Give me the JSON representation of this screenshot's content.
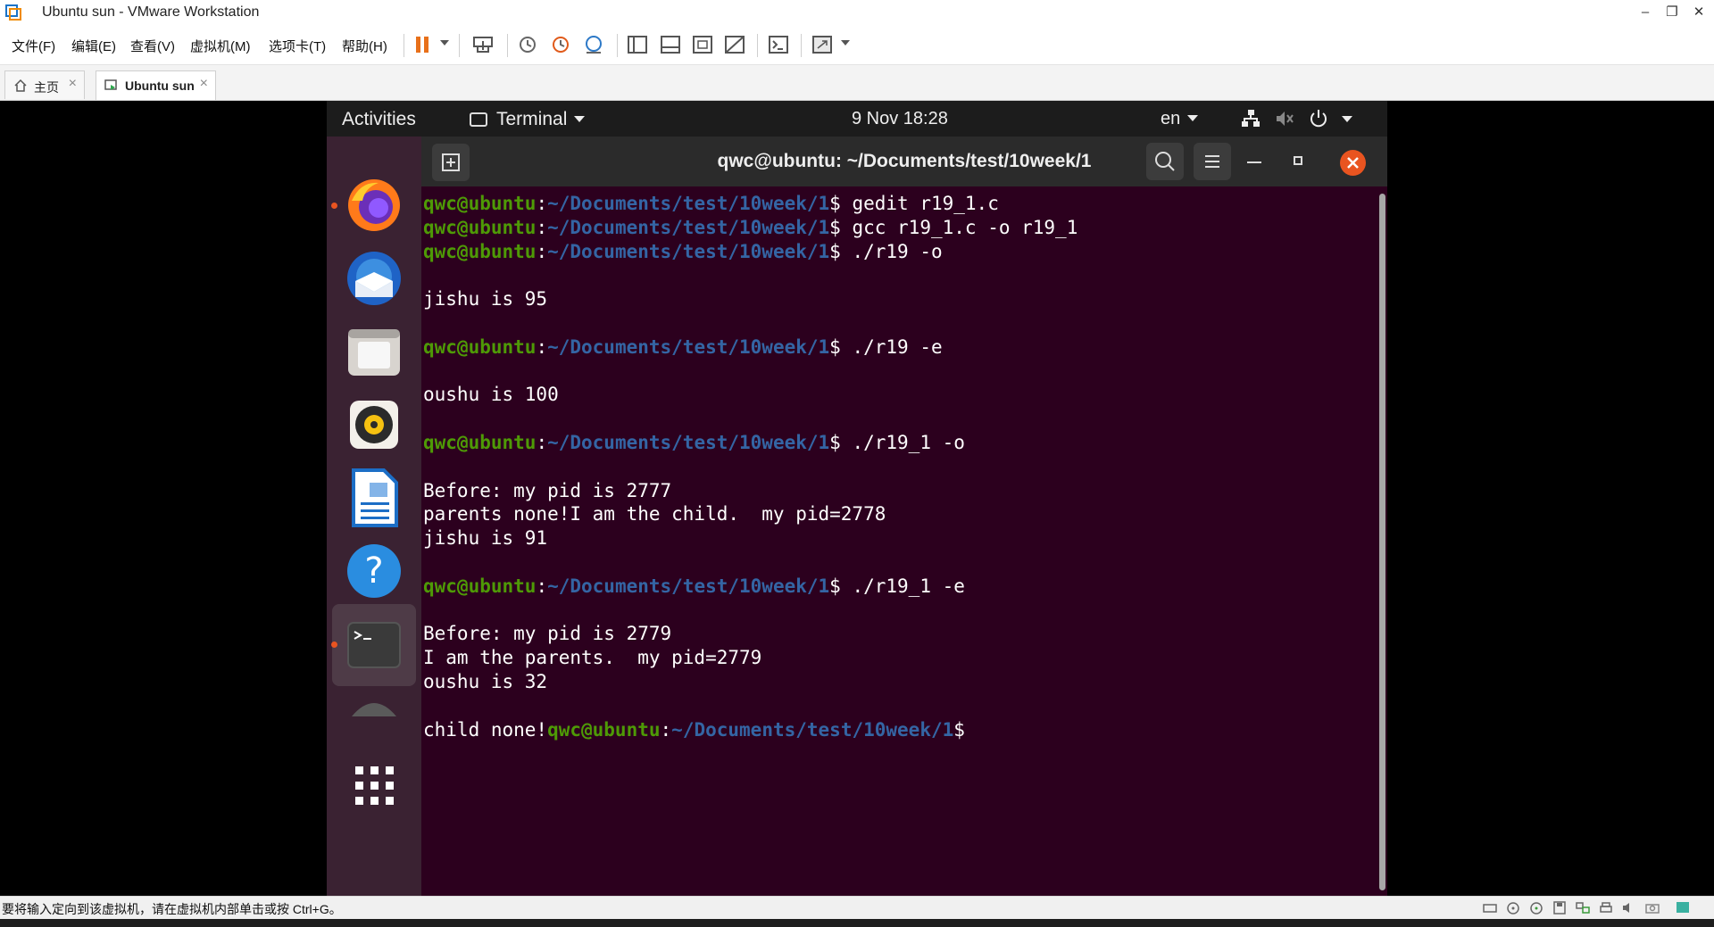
{
  "window": {
    "title": "Ubuntu sun - VMware Workstation",
    "controls": {
      "minimize": "–",
      "restore": "❐",
      "close": "✕"
    }
  },
  "menubar": {
    "items": [
      "文件(F)",
      "编辑(E)",
      "查看(V)",
      "虚拟机(M)",
      "选项卡(T)",
      "帮助(H)"
    ]
  },
  "tabs": [
    {
      "label": "主页",
      "icon": "home-icon",
      "active": false
    },
    {
      "label": "Ubuntu sun",
      "icon": "vm-icon",
      "active": true
    }
  ],
  "guest": {
    "topbar": {
      "activities": "Activities",
      "app_indicator": "Terminal",
      "clock": "9 Nov  18:28",
      "language": "en"
    },
    "dock": [
      "firefox-icon",
      "thunderbird-icon",
      "files-icon",
      "rhythmbox-icon",
      "writer-icon",
      "help-icon",
      "terminal-icon",
      "disk-icon",
      "app-grid-icon"
    ],
    "terminal": {
      "title": "qwc@ubuntu: ~/Documents/test/10week/1",
      "prompt_user": "qwc@ubuntu",
      "prompt_colon": ":",
      "prompt_path": "~/Documents/test/10week/1",
      "prompt_dollar": "$",
      "lines": [
        {
          "type": "prompt",
          "cmd": " gedit r19_1.c"
        },
        {
          "type": "prompt",
          "cmd": " gcc r19_1.c -o r19_1"
        },
        {
          "type": "prompt",
          "cmd": " ./r19 -o"
        },
        {
          "type": "out",
          "text": ""
        },
        {
          "type": "out",
          "text": "jishu is 95"
        },
        {
          "type": "out",
          "text": ""
        },
        {
          "type": "prompt",
          "cmd": " ./r19 -e"
        },
        {
          "type": "out",
          "text": ""
        },
        {
          "type": "out",
          "text": "oushu is 100"
        },
        {
          "type": "out",
          "text": ""
        },
        {
          "type": "prompt",
          "cmd": " ./r19_1 -o"
        },
        {
          "type": "out",
          "text": ""
        },
        {
          "type": "out",
          "text": "Before: my pid is 2777"
        },
        {
          "type": "out",
          "text": "parents none!I am the child.  my pid=2778"
        },
        {
          "type": "out",
          "text": "jishu is 91"
        },
        {
          "type": "out",
          "text": ""
        },
        {
          "type": "prompt",
          "cmd": " ./r19_1 -e"
        },
        {
          "type": "out",
          "text": ""
        },
        {
          "type": "out",
          "text": "Before: my pid is 2779"
        },
        {
          "type": "out",
          "text": "I am the parents.  my pid=2779"
        },
        {
          "type": "out",
          "text": "oushu is 32"
        },
        {
          "type": "out",
          "text": ""
        },
        {
          "type": "prefix_prompt",
          "prefix": "child none!",
          "cmd": ""
        }
      ]
    }
  },
  "statusbar": {
    "message": "要将输入定向到该虚拟机，请在虚拟机内部单击或按 Ctrl+G。"
  },
  "colors": {
    "terminal_bg": "#2c001e",
    "prompt_user": "#4e9a06",
    "prompt_path": "#3465a4",
    "ubuntu_orange": "#e95420",
    "vmware_pause": "#e8701a"
  }
}
